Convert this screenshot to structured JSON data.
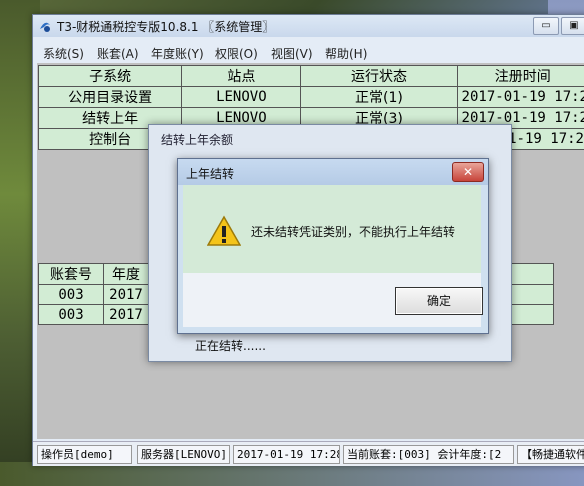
{
  "app": {
    "title": "T3-财税通税控专版10.8.1 〖系统管理〗",
    "menu": [
      "系统(S)",
      "账套(A)",
      "年度账(Y)",
      "权限(O)",
      "视图(V)",
      "帮助(H)"
    ]
  },
  "subsystem_table": {
    "headers": [
      "子系统",
      "站点",
      "运行状态",
      "注册时间"
    ],
    "rows": [
      [
        "公用目录设置",
        "LENOVO",
        "正常(1)",
        "2017-01-19 17:2"
      ],
      [
        "结转上年",
        "LENOVO",
        "正常(3)",
        "2017-01-19 17:2"
      ],
      [
        "控制台",
        "",
        "",
        "01-19 17:2"
      ]
    ]
  },
  "account_table": {
    "headers": [
      "账套号",
      "年度",
      ""
    ],
    "rows": [
      [
        "003",
        "2017",
        ""
      ],
      [
        "003",
        "2017",
        ""
      ]
    ]
  },
  "status_bar": {
    "operator": "操作员[demo]",
    "server": "服务器[LENOVO]",
    "datetime": "2017-01-19 17:28",
    "current_account": "当前账套:[003] 会计年度:[2",
    "brand": "【畅捷通软件"
  },
  "progress_dialog": {
    "title": "结转上年余额",
    "status": "正在结转......"
  },
  "message_box": {
    "title": "上年结转",
    "message": "还未结转凭证类别，不能执行上年结转",
    "ok_label": "确定",
    "icon": "warning-icon"
  },
  "colors": {
    "grid_bg": "#d2ecd4",
    "msg_body_bg": "#d4ead7",
    "close_red": "#c7443a"
  }
}
